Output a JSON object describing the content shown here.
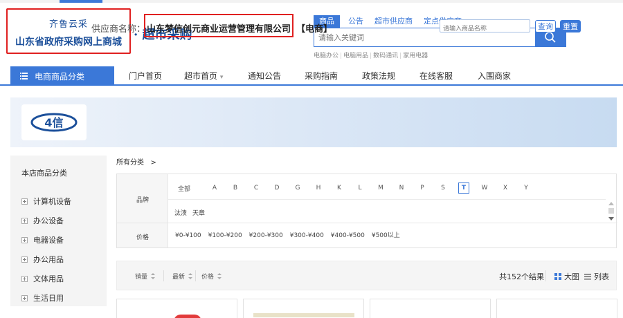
{
  "header": {
    "logo_top": "齐鲁云采",
    "logo_main": "山东省政府采购网上商城",
    "logo_sub": "· 超市采购"
  },
  "search": {
    "tabs": [
      "商品",
      "公告",
      "超市供应商",
      "定点供应商"
    ],
    "active_tab": "商品",
    "placeholder": "请输入关键词",
    "hotwords": [
      "电脑办公",
      "电脑用品",
      "数码通讯",
      "家用电器"
    ],
    "separator": "|"
  },
  "nav": {
    "category_label": "电商商品分类",
    "items": [
      "门户首页",
      "超市首页",
      "通知公告",
      "采购指南",
      "政策法规",
      "在线客服",
      "入围商家"
    ],
    "dropdown_mark": "▾"
  },
  "supplier": {
    "logo_text": "4信",
    "label": "供应商名称：",
    "name": "山东梦信创元商业运营管理有限公司",
    "tag": "【电商】",
    "search_placeholder": "请输入商品名称",
    "query_label": "查询",
    "reset_label": "重置"
  },
  "sidebar": {
    "title": "本店商品分类",
    "items": [
      "计算机设备",
      "办公设备",
      "电器设备",
      "办公用品",
      "文体用品",
      "生活日用"
    ]
  },
  "breadcrumb": {
    "text": "所有分类",
    "arrow": ">"
  },
  "filter": {
    "brand_label": "品牌",
    "price_label": "价格",
    "letters": [
      "全部",
      "A",
      "B",
      "C",
      "D",
      "G",
      "H",
      "K",
      "L",
      "M",
      "N",
      "P",
      "S",
      "T",
      "W",
      "X",
      "Y"
    ],
    "active_letter": "T",
    "brands": [
      "汰渍",
      "天章"
    ],
    "prices": [
      "¥0-¥100",
      "¥100-¥200",
      "¥200-¥300",
      "¥300-¥400",
      "¥400-¥500",
      "¥500以上"
    ]
  },
  "sort": {
    "options": [
      "销量",
      "最新",
      "价格"
    ],
    "total": "共152个结果",
    "view_big": "大图",
    "view_list": "列表"
  },
  "colors": {
    "primary": "#3b78d8",
    "highlight_border": "#e02020",
    "logo_text": "#1b4f9a"
  },
  "icons": {
    "nav_menu": "menu-icon",
    "search": "search-icon",
    "expand": "plus-icon",
    "sort": "sort-arrows-icon",
    "grid": "grid-icon",
    "list": "list-icon"
  }
}
